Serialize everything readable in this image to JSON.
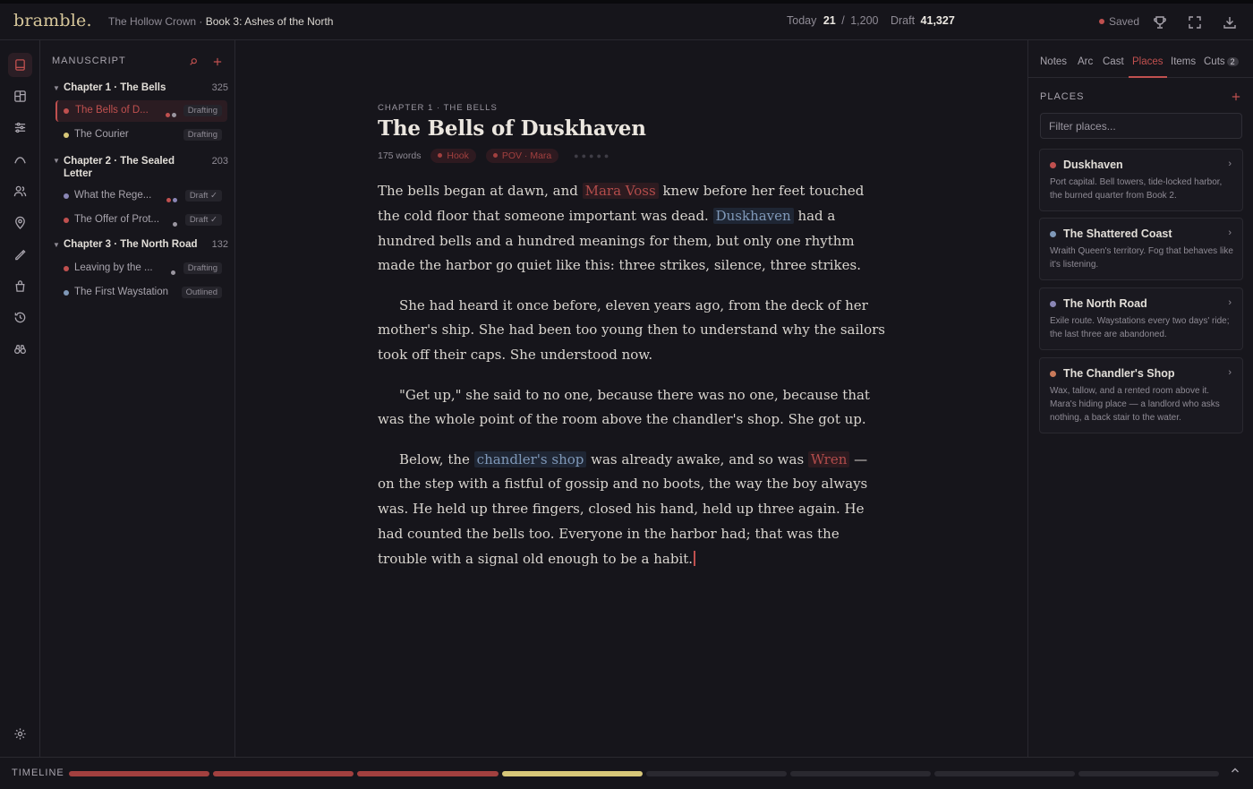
{
  "app": {
    "logo": "bramble."
  },
  "breadcrumb": {
    "series": "The Hollow Crown",
    "separator": " · ",
    "book": "Book 3: Ashes of the North"
  },
  "stats": {
    "today_label": "Today",
    "today_value": "21",
    "slash": "/",
    "today_goal": "1,200",
    "draft_label": "Draft",
    "draft_value": "41,327"
  },
  "status": {
    "saved": "Saved"
  },
  "topbar_icons": [
    "trophy-icon",
    "fullscreen-icon",
    "download-icon"
  ],
  "rail_icons": [
    "manuscript-icon",
    "board-icon",
    "sliders-icon",
    "arc-icon",
    "cast-icon",
    "places-icon",
    "pen-icon",
    "items-icon",
    "history-icon",
    "binoculars-icon",
    "settings-icon"
  ],
  "manuscript": {
    "heading": "MANUSCRIPT",
    "chapters": [
      {
        "title": "Chapter 1 · The Bells",
        "count": "325",
        "scenes": [
          {
            "title": "The Bells of D...",
            "status": "Drafting",
            "dot": "#c0504f",
            "pov": [
              "#c0504f",
              "#9a96a0"
            ]
          },
          {
            "title": "The Courier",
            "status": "Drafting",
            "dot": "#d7c779",
            "pov": []
          }
        ]
      },
      {
        "title": "Chapter 2 · The Sealed Letter",
        "count": "203",
        "scenes": [
          {
            "title": "What the Rege...",
            "status": "Draft ✓",
            "dot": "#8a86b5",
            "pov": [
              "#c0504f",
              "#8a86b5"
            ]
          },
          {
            "title": "The Offer of Prot...",
            "status": "Draft ✓",
            "dot": "#c0504f",
            "pov": [
              "#9a96a0"
            ]
          }
        ]
      },
      {
        "title": "Chapter 3 · The North Road",
        "count": "132",
        "scenes": [
          {
            "title": "Leaving by the ...",
            "status": "Drafting",
            "dot": "#c0504f",
            "pov": [
              "#9a96a0"
            ]
          },
          {
            "title": "The First Waystation",
            "status": "Outlined",
            "dot": "#7f98b8",
            "pov": []
          }
        ]
      }
    ]
  },
  "editor": {
    "eyebrow": "CHAPTER 1 · THE BELLS",
    "title": "The Bells of Duskhaven",
    "word_count": "175 words",
    "tag_hook": "Hook",
    "tag_pov": "POV · Mara",
    "rating": 0,
    "rating_max": 5,
    "p1": {
      "a": "The bells began at dawn, and ",
      "char1": "Mara Voss",
      "b": " knew before her feet touched the cold floor that someone important was dead. ",
      "place1": "Duskhaven",
      "c": " had a hundred bells and a hundred meanings for them, but only one rhythm made the harbor go quiet like this: three strikes, silence, three strikes."
    },
    "p2": "She had heard it once before, eleven years ago, from the deck of her mother's ship. She had been too young then to understand why the sailors took off their caps. She understood now.",
    "p3": "\"Get up,\" she said to no one, because there was no one, because that was the whole point of the room above the chandler's shop. She got up.",
    "p4": {
      "a": "Below, the ",
      "place": "chandler's shop",
      "b": " was already awake, and so was ",
      "char": "Wren",
      "c": " — on the step with a fistful of gossip and no boots, the way the boy always was. He held up three fingers, closed his hand, held up three again. He had counted the bells too. Everyone in the harbor had; that was the trouble with a signal old enough to be a habit."
    }
  },
  "right_panel": {
    "tabs": [
      "Notes",
      "Arc",
      "Cast",
      "Places",
      "Items",
      "Cuts"
    ],
    "active_tab": "Places",
    "cuts_count": "2",
    "heading": "PLACES",
    "filter_placeholder": "Filter places...",
    "places": [
      {
        "name": "Duskhaven",
        "dot": "#c0504f",
        "desc": "Port capital. Bell towers, tide-locked harbor, the burned quarter from Book 2."
      },
      {
        "name": "The Shattered Coast",
        "dot": "#7f98b8",
        "desc": "Wraith Queen's territory. Fog that behaves like it's listening."
      },
      {
        "name": "The North Road",
        "dot": "#8a86b5",
        "desc": "Exile route. Waystations every two days' ride; the last three are abandoned."
      },
      {
        "name": "The Chandler's Shop",
        "dot": "#c97a5a",
        "desc": "Wax, tallow, and a rented room above it. Mara's hiding place — a landlord who asks nothing, a back stair to the water."
      }
    ]
  },
  "timeline": {
    "label": "TIMELINE",
    "segments": [
      "#a2403f",
      "#a2403f",
      "#a2403f",
      "#d7c779",
      "#2a2930",
      "#2a2930",
      "#2a2930",
      "#2a2930"
    ]
  },
  "colors": {
    "accent": "#c0504f",
    "gold": "#d7c79b",
    "background": "#16151b"
  }
}
